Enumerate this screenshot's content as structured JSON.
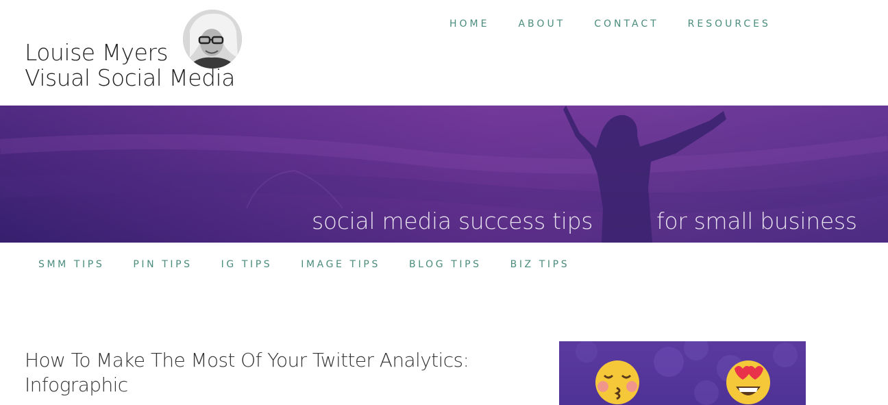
{
  "site": {
    "title_line1": "Louise Myers",
    "title_line2": "Visual Social Media"
  },
  "main_nav": [
    "HOME",
    "ABOUT",
    "CONTACT",
    "RESOURCES"
  ],
  "banner": {
    "tagline_part1": "social media success tips",
    "tagline_part2": "for small business"
  },
  "category_nav": [
    "SMM TIPS",
    "PIN TIPS",
    "IG TIPS",
    "IMAGE TIPS",
    "BLOG TIPS",
    "BIZ TIPS"
  ],
  "post": {
    "title": "How To Make The Most Of Your Twitter Analytics: Infographic"
  },
  "colors": {
    "nav_text": "#4a8c7c",
    "banner_purple": "#6f3797",
    "title_text": "#222222"
  }
}
